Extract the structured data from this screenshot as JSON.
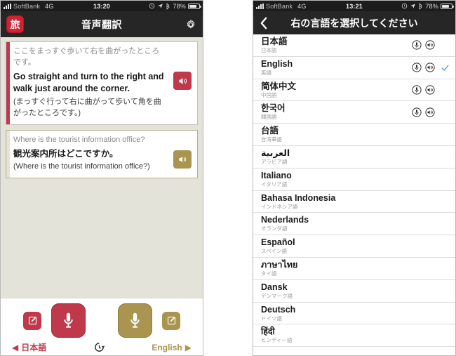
{
  "left_phone": {
    "status_bar": {
      "carrier": "SoftBank",
      "network": "4G",
      "time": "13:20",
      "battery_text": "78%",
      "icons": [
        "signal-bars-icon",
        "alarm-icon",
        "location-arrow-icon",
        "bluetooth-icon",
        "battery-icon"
      ]
    },
    "navbar": {
      "app_badge_char": "旅",
      "title": "音声翻訳",
      "settings_icon": "gear-icon"
    },
    "cards": [
      {
        "accent_color": "#c0394b",
        "source_text": "ここをまっすぐ歩いて右を曲がったところです。",
        "translated_text": "Go straight and turn to the right and walk just around the corner.",
        "back_translation": "(まっすぐ行って右に曲がって歩いて角を曲がったところです。)",
        "speaker_icon": "speaker-icon"
      },
      {
        "accent_color": "#a9954f",
        "source_text": "Where is the tourist information office?",
        "translated_text": "観光案内所はどこですか。",
        "back_translation": "(Where is the tourist information office?)",
        "speaker_icon": "speaker-icon"
      }
    ],
    "bottom_bar": {
      "left_edit_icon": "edit-note-icon",
      "left_mic_icon": "microphone-icon",
      "right_mic_icon": "microphone-icon",
      "right_edit_icon": "edit-note-icon",
      "left_lang_label": "日本語",
      "left_arrow": "◀",
      "history_icon": "history-clock-icon",
      "right_lang_label": "English",
      "right_arrow": "▶",
      "left_color": "#c0394b",
      "right_color": "#a9954f"
    }
  },
  "right_phone": {
    "status_bar": {
      "carrier": "SoftBank",
      "network": "4G",
      "time": "13:21",
      "battery_text": "78%"
    },
    "navbar": {
      "back_icon": "chevron-left-icon",
      "title": "右の言語を選択してください"
    },
    "selected_language": "English",
    "check_color": "#3d9ae0",
    "languages": [
      {
        "name": "日本語",
        "sub": "日本語",
        "mic": true,
        "speaker": true,
        "selected": false
      },
      {
        "name": "English",
        "sub": "英語",
        "mic": true,
        "speaker": true,
        "selected": true
      },
      {
        "name": "简体中文",
        "sub": "中国語",
        "mic": true,
        "speaker": true,
        "selected": false
      },
      {
        "name": "한국어",
        "sub": "韓国語",
        "mic": true,
        "speaker": true,
        "selected": false
      },
      {
        "name": "台語",
        "sub": "台湾華語",
        "mic": false,
        "speaker": false,
        "selected": false
      },
      {
        "name": "العربية",
        "sub": "アラビア語",
        "mic": false,
        "speaker": false,
        "selected": false
      },
      {
        "name": "Italiano",
        "sub": "イタリア語",
        "mic": false,
        "speaker": false,
        "selected": false
      },
      {
        "name": "Bahasa Indonesia",
        "sub": "インドネシア語",
        "mic": false,
        "speaker": false,
        "selected": false
      },
      {
        "name": "Nederlands",
        "sub": "オランダ語",
        "mic": false,
        "speaker": false,
        "selected": false
      },
      {
        "name": "Español",
        "sub": "スペイン語",
        "mic": false,
        "speaker": false,
        "selected": false
      },
      {
        "name": "ภาษาไทย",
        "sub": "タイ語",
        "mic": false,
        "speaker": false,
        "selected": false
      },
      {
        "name": "Dansk",
        "sub": "デンマーク語",
        "mic": false,
        "speaker": false,
        "selected": false
      },
      {
        "name": "Deutsch",
        "sub": "ドイツ語",
        "mic": false,
        "speaker": false,
        "selected": false
      },
      {
        "name": "हिंदी",
        "sub": "ヒンディー語",
        "mic": false,
        "speaker": false,
        "selected": false
      }
    ]
  }
}
